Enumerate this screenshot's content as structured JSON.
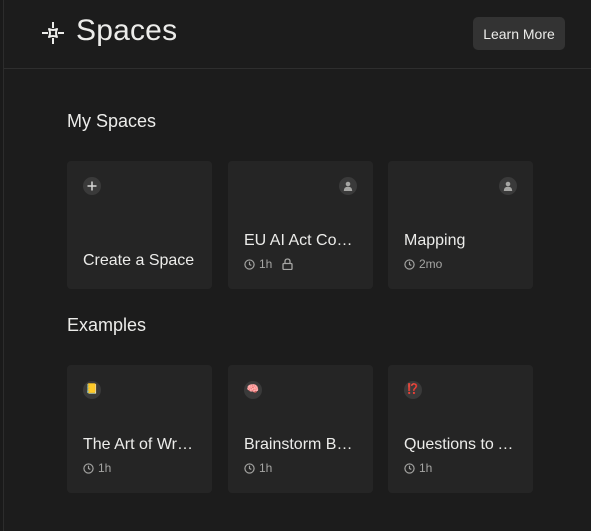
{
  "header": {
    "title": "Spaces",
    "learn_more_label": "Learn More",
    "icon": "spaces-sparkle-icon"
  },
  "my_spaces": {
    "title": "My Spaces",
    "cards": [
      {
        "title": "Create a Space",
        "icon": "plus-icon",
        "time": "",
        "locked": false
      },
      {
        "title": "EU AI Act Compliance",
        "icon": "user-icon",
        "time": "1h",
        "locked": true
      },
      {
        "title": "Mapping",
        "icon": "user-icon",
        "time": "2mo",
        "locked": false
      }
    ]
  },
  "examples": {
    "title": "Examples",
    "cards": [
      {
        "title": "The Art of Writing",
        "emoji": "📒",
        "time": "1h"
      },
      {
        "title": "Brainstorm Buddy",
        "emoji": "🧠",
        "time": "1h"
      },
      {
        "title": "Questions to Ask",
        "emoji": "⁉️",
        "time": "1h"
      }
    ]
  },
  "colors": {
    "background": "#1c1c1c",
    "card": "#252525",
    "button": "#333333",
    "text": "#ececea",
    "muted": "#a5a5a3"
  }
}
